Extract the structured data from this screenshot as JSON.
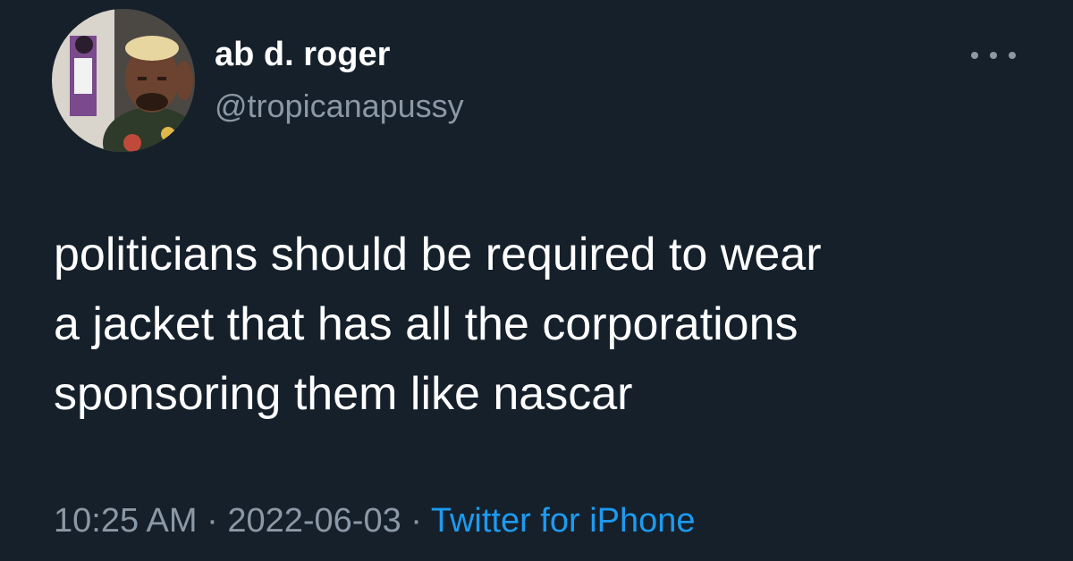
{
  "tweet": {
    "author": {
      "display_name": "ab d. roger",
      "handle": "@tropicanapussy"
    },
    "text_lines": [
      "politicians should be required to wear",
      "a jacket that has all the corporations",
      "sponsoring them like nascar"
    ],
    "time": "10:25 AM",
    "separator": "·",
    "date": "2022-06-03",
    "source": "Twitter for iPhone"
  },
  "icons": {
    "more": "more-options-icon"
  },
  "colors": {
    "background": "#15202b",
    "primary_text": "#ffffff",
    "secondary_text": "#8b98a5",
    "link": "#1d9bf0"
  }
}
